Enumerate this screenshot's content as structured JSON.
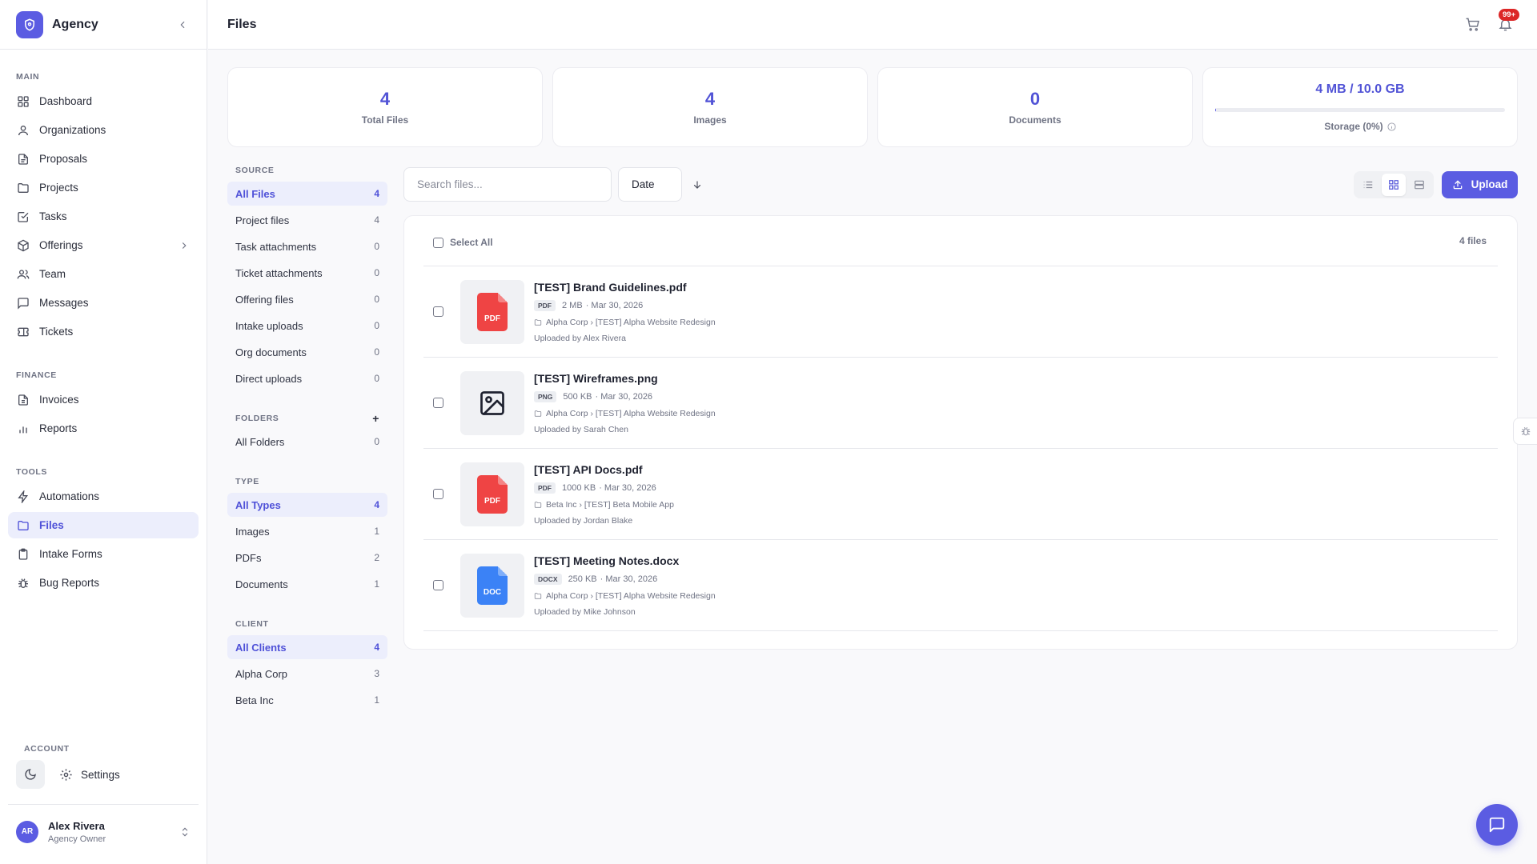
{
  "brand": {
    "name": "Agency",
    "icon": "shield-icon",
    "accent": "#5b5ce2"
  },
  "sidebar": {
    "sections": [
      {
        "label": "MAIN",
        "items": [
          {
            "label": "Dashboard",
            "icon": "dashboard-icon"
          },
          {
            "label": "Organizations",
            "icon": "user-icon"
          },
          {
            "label": "Proposals",
            "icon": "document-icon"
          },
          {
            "label": "Projects",
            "icon": "folder-icon"
          },
          {
            "label": "Tasks",
            "icon": "task-check-icon"
          },
          {
            "label": "Offerings",
            "icon": "box-icon"
          },
          {
            "label": "Team",
            "icon": "team-icon"
          },
          {
            "label": "Messages",
            "icon": "message-icon"
          },
          {
            "label": "Tickets",
            "icon": "ticket-icon"
          }
        ]
      },
      {
        "label": "FINANCE",
        "items": [
          {
            "label": "Invoices",
            "icon": "invoice-icon"
          },
          {
            "label": "Reports",
            "icon": "bar-chart-icon"
          }
        ]
      },
      {
        "label": "TOOLS",
        "items": [
          {
            "label": "Automations",
            "icon": "lightning-icon"
          },
          {
            "label": "Files",
            "icon": "folder-icon",
            "active": true
          },
          {
            "label": "Intake Forms",
            "icon": "clipboard-icon"
          },
          {
            "label": "Bug Reports",
            "icon": "bug-icon"
          }
        ]
      }
    ],
    "account_label": "ACCOUNT",
    "settings_label": "Settings",
    "user": {
      "initials": "AR",
      "name": "Alex Rivera",
      "role": "Agency Owner"
    }
  },
  "header": {
    "title": "Files",
    "notification_badge": "99+"
  },
  "stats": {
    "total_files": {
      "value": "4",
      "label": "Total Files"
    },
    "images": {
      "value": "4",
      "label": "Images"
    },
    "documents": {
      "value": "0",
      "label": "Documents"
    },
    "storage": {
      "value": "4 MB / 10.0 GB",
      "label": "Storage (0%)",
      "fraction": 0.0004
    }
  },
  "filters": {
    "source": {
      "label": "SOURCE",
      "items": [
        {
          "label": "All Files",
          "count": "4",
          "active": true
        },
        {
          "label": "Project files",
          "count": "4"
        },
        {
          "label": "Task attachments",
          "count": "0"
        },
        {
          "label": "Ticket attachments",
          "count": "0"
        },
        {
          "label": "Offering files",
          "count": "0"
        },
        {
          "label": "Intake uploads",
          "count": "0"
        },
        {
          "label": "Org documents",
          "count": "0"
        },
        {
          "label": "Direct uploads",
          "count": "0"
        }
      ]
    },
    "folders": {
      "label": "FOLDERS",
      "add": "+",
      "items": [
        {
          "label": "All Folders",
          "count": "0"
        }
      ]
    },
    "type": {
      "label": "TYPE",
      "items": [
        {
          "label": "All Types",
          "count": "4",
          "active": true
        },
        {
          "label": "Images",
          "count": "1"
        },
        {
          "label": "PDFs",
          "count": "2"
        },
        {
          "label": "Documents",
          "count": "1"
        }
      ]
    },
    "client": {
      "label": "CLIENT",
      "items": [
        {
          "label": "All Clients",
          "count": "4",
          "active": true
        },
        {
          "label": "Alpha Corp",
          "count": "3"
        },
        {
          "label": "Beta Inc",
          "count": "1"
        }
      ]
    }
  },
  "toolbar": {
    "search_placeholder": "Search files...",
    "search_value": "",
    "sort_value": "Date",
    "upload_label": "Upload",
    "active_view": "grid"
  },
  "file_list": {
    "select_all": "Select All",
    "count_label": "4 files",
    "files": [
      {
        "name": "[TEST] Brand Guidelines.pdf",
        "thumb": "pdf",
        "thumb_text": "PDF",
        "ext": "PDF",
        "size": "2 MB",
        "date": "· Mar 30, 2026",
        "path": "Alpha Corp › [TEST] Alpha Website Redesign",
        "uploader": "Uploaded by Alex Rivera"
      },
      {
        "name": "[TEST] Wireframes.png",
        "thumb": "image",
        "thumb_text": "",
        "ext": "PNG",
        "size": "500 KB",
        "date": "· Mar 30, 2026",
        "path": "Alpha Corp › [TEST] Alpha Website Redesign",
        "uploader": "Uploaded by Sarah Chen"
      },
      {
        "name": "[TEST] API Docs.pdf",
        "thumb": "pdf",
        "thumb_text": "PDF",
        "ext": "PDF",
        "size": "1000 KB",
        "date": "· Mar 30, 2026",
        "path": "Beta Inc › [TEST] Beta Mobile App",
        "uploader": "Uploaded by Jordan Blake"
      },
      {
        "name": "[TEST] Meeting Notes.docx",
        "thumb": "doc",
        "thumb_text": "DOC",
        "ext": "DOCX",
        "size": "250 KB",
        "date": "· Mar 30, 2026",
        "path": "Alpha Corp › [TEST] Alpha Website Redesign",
        "uploader": "Uploaded by Mike Johnson"
      }
    ]
  }
}
